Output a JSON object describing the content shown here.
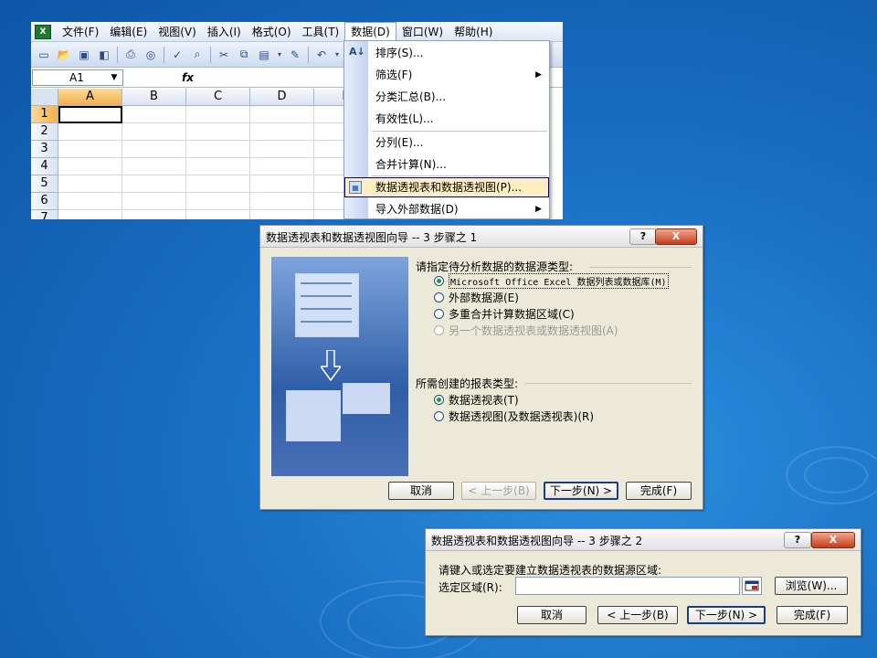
{
  "excel": {
    "app_icon_label": "X",
    "menu": [
      {
        "label": "文件(F)"
      },
      {
        "label": "编辑(E)"
      },
      {
        "label": "视图(V)"
      },
      {
        "label": "插入(I)"
      },
      {
        "label": "格式(O)"
      },
      {
        "label": "工具(T)"
      },
      {
        "label": "数据(D)"
      },
      {
        "label": "窗口(W)"
      },
      {
        "label": "帮助(H)"
      }
    ],
    "toolbar_icons": [
      "new-icon",
      "open-icon",
      "save-icon",
      "permission-icon",
      "print-icon",
      "print-preview-icon",
      "spelling-icon",
      "research-icon",
      "cut-icon",
      "copy-icon",
      "paste-icon",
      "format-painter-icon",
      "undo-icon"
    ],
    "name_box": "A1",
    "fx_label": "fx",
    "columns": [
      "A",
      "B",
      "C",
      "D",
      "E"
    ],
    "rows": [
      "1",
      "2",
      "3",
      "4",
      "5",
      "6",
      "7"
    ]
  },
  "data_menu": {
    "items": [
      {
        "label": "排序(S)..."
      },
      {
        "label": "筛选(F)"
      },
      {
        "label": "分类汇总(B)..."
      },
      {
        "label": "有效性(L)..."
      },
      {
        "label": "分列(E)..."
      },
      {
        "label": "合并计算(N)..."
      },
      {
        "label": "数据透视表和数据透视图(P)..."
      },
      {
        "label": "导入外部数据(D)"
      }
    ]
  },
  "step1": {
    "title": "数据透视表和数据透视图向导 -- 3 步骤之 1",
    "help_label": "?",
    "close_label": "X",
    "source_label": "请指定待分析数据的数据源类型:",
    "source_options": [
      {
        "label": "Microsoft Office Excel 数据列表或数据库(M)"
      },
      {
        "label": "外部数据源(E)"
      },
      {
        "label": "多重合并计算数据区域(C)"
      },
      {
        "label": "另一个数据透视表或数据透视图(A)"
      }
    ],
    "report_label": "所需创建的报表类型:",
    "report_options": [
      {
        "label": "数据透视表(T)"
      },
      {
        "label": "数据透视图(及数据透视表)(R)"
      }
    ],
    "buttons": {
      "cancel": "取消",
      "back": "< 上一步(B)",
      "next": "下一步(N) >",
      "finish": "完成(F)"
    }
  },
  "step2": {
    "title": "数据透视表和数据透视图向导 -- 3 步骤之 2",
    "help_label": "?",
    "close_label": "X",
    "prompt": "请键入或选定要建立数据透视表的数据源区域:",
    "range_label": "选定区域(R):",
    "range_value": "",
    "browse": "浏览(W)...",
    "buttons": {
      "cancel": "取消",
      "back": "< 上一步(B)",
      "next": "下一步(N) >",
      "finish": "完成(F)"
    }
  }
}
